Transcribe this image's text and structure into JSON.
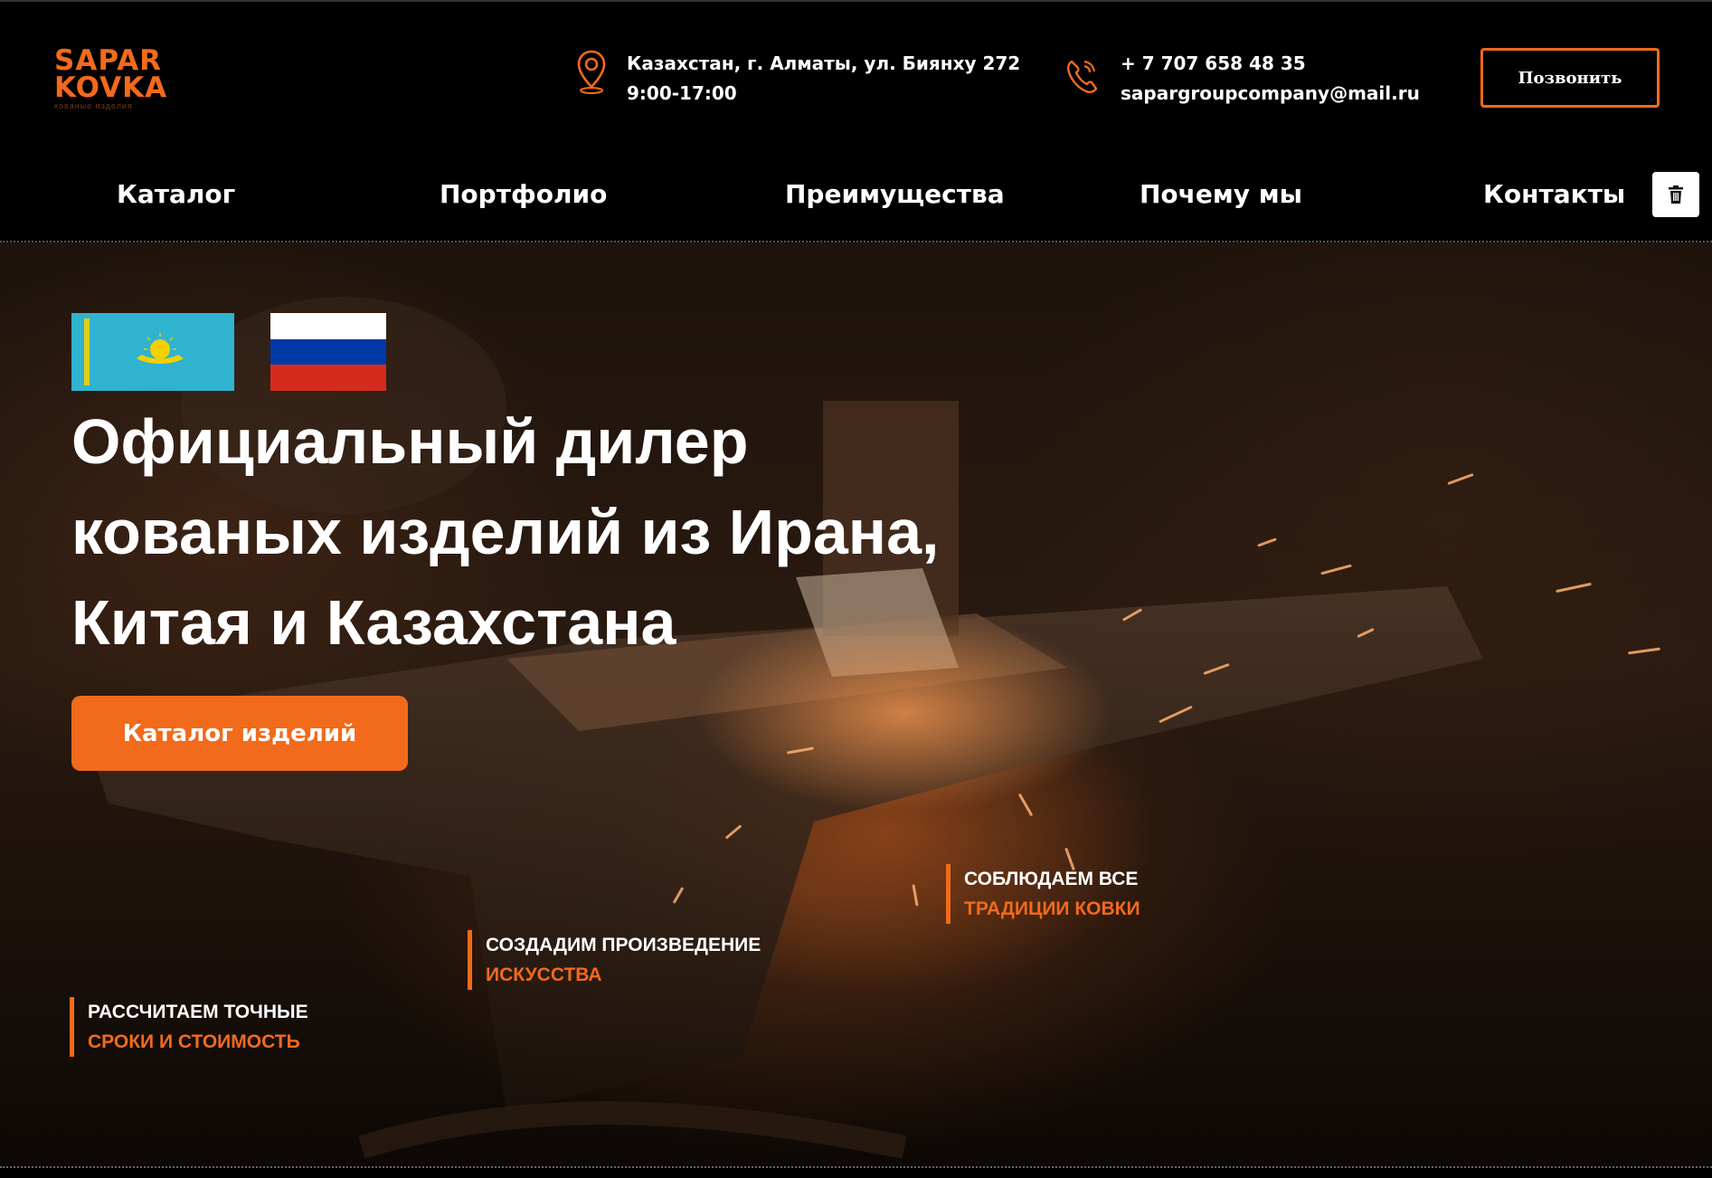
{
  "header": {
    "logo": {
      "line1": "SAPAR",
      "line2": "KOVKA",
      "tagline": "кованые изделия"
    },
    "address": {
      "line1": "Казахстан, г. Алматы, ул. Биянху 272",
      "line2": "9:00-17:00",
      "icon": "location-pin-icon"
    },
    "phone": {
      "line1": "+ 7 707 658 48 35",
      "line2": "sapargroupcompany@mail.ru",
      "icon": "phone-icon"
    },
    "call_button": "Позвонить"
  },
  "nav": {
    "items": [
      "Каталог",
      "Портфолио",
      "Преимущества",
      "Почему мы",
      "Контакты"
    ],
    "action_icon": "trash-icon"
  },
  "hero": {
    "flags": [
      "kazakhstan-flag",
      "russia-flag"
    ],
    "title": [
      "Официальный дилер",
      "кованых изделий из Ирана,",
      "Китая и Казахстана"
    ],
    "cta": "Каталог изделий",
    "features": [
      {
        "line1": "РАССЧИТАЕМ ТОЧНЫЕ",
        "line2": "СРОКИ И СТОИМОСТЬ"
      },
      {
        "line1": "СОЗДАДИМ ПРОИЗВЕДЕНИЕ",
        "line2": "ИСКУССТВА"
      },
      {
        "line1": "СОБЛЮДАЕМ ВСЕ",
        "line2": "ТРАДИЦИИ КОВКИ"
      }
    ]
  },
  "colors": {
    "accent": "#f26a1b",
    "background": "#000000",
    "kz_flag": "#2fb3cf",
    "kz_emblem": "#f5d000",
    "ru_white": "#ffffff",
    "ru_blue": "#0039a6",
    "ru_red": "#d52b1e"
  }
}
